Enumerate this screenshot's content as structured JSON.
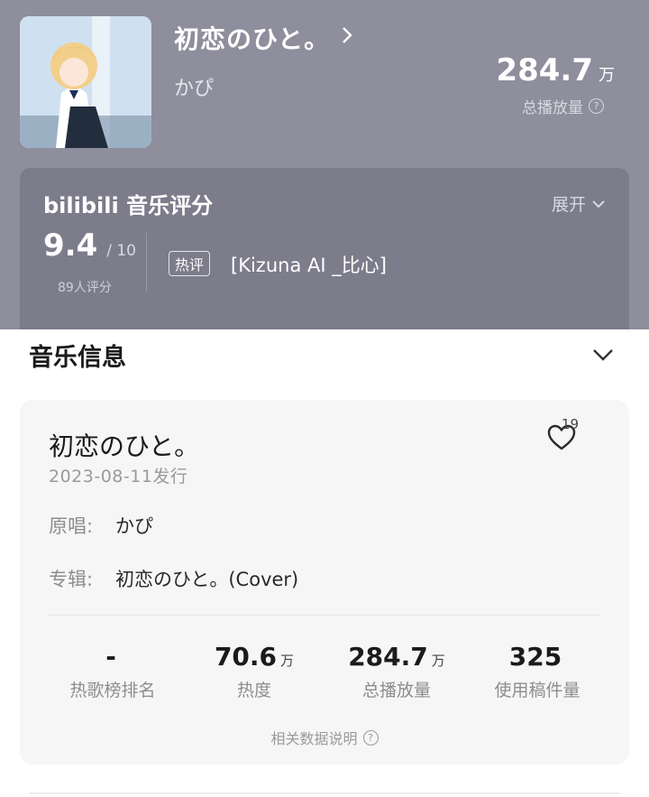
{
  "song": {
    "title": "初恋のひと。",
    "artist": "かぴ",
    "total_plays_value": "284.7",
    "total_plays_unit": "万",
    "total_plays_label": "总播放量"
  },
  "rating": {
    "title": "bilibili 音乐评分",
    "expand_label": "展开",
    "score": "9.4",
    "score_max": "/ 10",
    "raters": "89人评分",
    "hot_badge": "热评",
    "hot_comment": "[Kizuna AI _比心]"
  },
  "music_info": {
    "header": "音乐信息",
    "title": "初恋のひと。",
    "likes": "19",
    "release": "2023-08-11发行",
    "original_label": "原唱:",
    "original_value": "かぴ",
    "album_label": "专辑:",
    "album_value": "初恋のひと。(Cover)",
    "stats": [
      {
        "value": "-",
        "unit": "",
        "label": "热歌榜排名"
      },
      {
        "value": "70.6",
        "unit": "万",
        "label": "热度"
      },
      {
        "value": "284.7",
        "unit": "万",
        "label": "总播放量"
      },
      {
        "value": "325",
        "unit": "",
        "label": "使用稿件量"
      }
    ],
    "data_note": "相关数据说明"
  },
  "icons": {
    "title_chevron": "chevron-right-icon",
    "question": "question-circle-icon",
    "expand": "chevron-down-icon",
    "collapse": "chevron-down-icon",
    "like": "heart-outline-icon"
  },
  "colors": {
    "header_bg": "#8e8e9c",
    "rating_card_bg": "#7c7c8b",
    "info_card_bg": "#f6f6f7"
  }
}
